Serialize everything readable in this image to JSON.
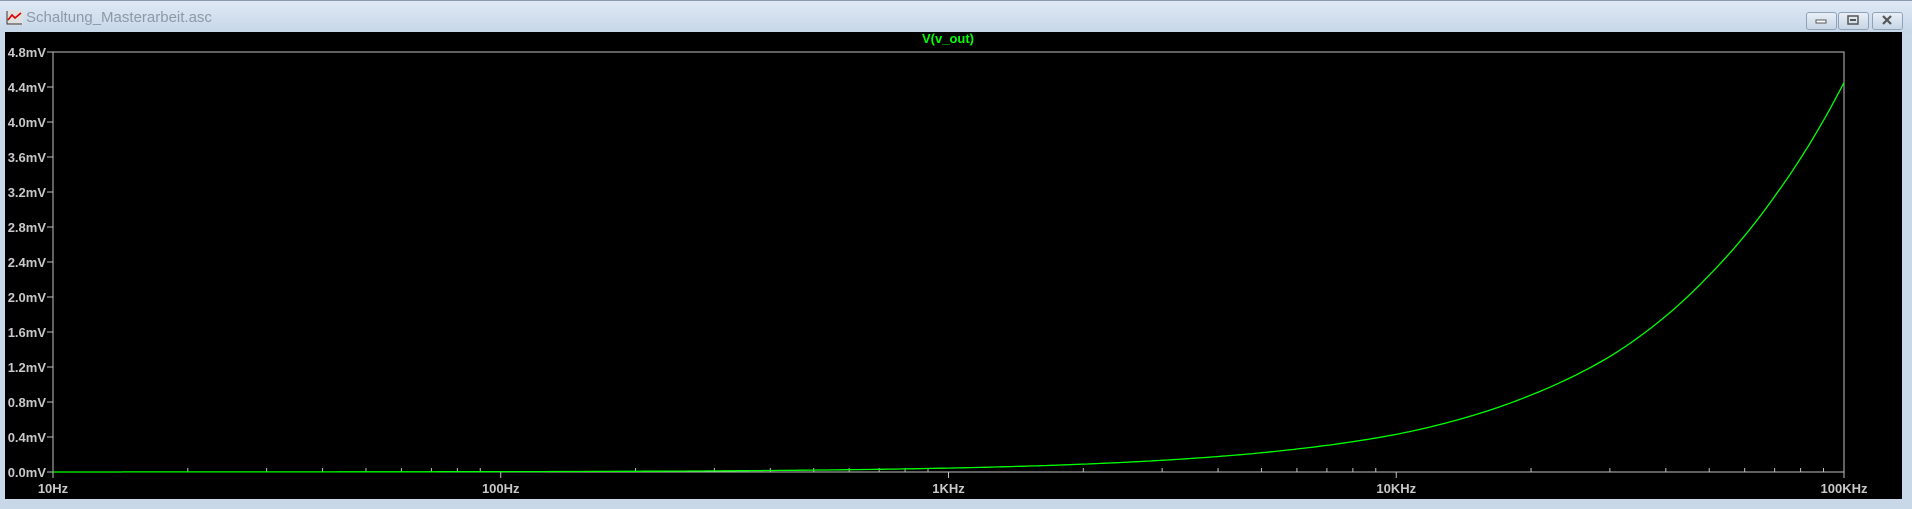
{
  "window": {
    "title": "Schaltung_Masterarbeit.asc",
    "buttons": [
      "minimize",
      "restore",
      "close"
    ]
  },
  "colors": {
    "trace": "#00ff00",
    "axis": "#c0c0c0",
    "background": "#000000"
  },
  "chart_data": {
    "type": "line",
    "title": "V(v_out)",
    "xscale": "log",
    "xlim": [
      10,
      100000
    ],
    "ylim": [
      0,
      4.8
    ],
    "x_ticks": [
      "10Hz",
      "100Hz",
      "1KHz",
      "10KHz",
      "100KHz"
    ],
    "y_ticks": [
      "0.0mV",
      "0.4mV",
      "0.8mV",
      "1.2mV",
      "1.6mV",
      "2.0mV",
      "2.4mV",
      "2.8mV",
      "3.2mV",
      "3.6mV",
      "4.0mV",
      "4.4mV",
      "4.8mV"
    ],
    "series": [
      {
        "name": "V(v_out)",
        "x": [
          10,
          100,
          1000,
          2000,
          5000,
          10000,
          20000,
          30000,
          50000,
          70000,
          100000
        ],
        "y": [
          0.0004,
          0.004,
          0.045,
          0.09,
          0.22,
          0.43,
          0.88,
          1.32,
          2.25,
          3.15,
          4.45
        ]
      }
    ]
  }
}
